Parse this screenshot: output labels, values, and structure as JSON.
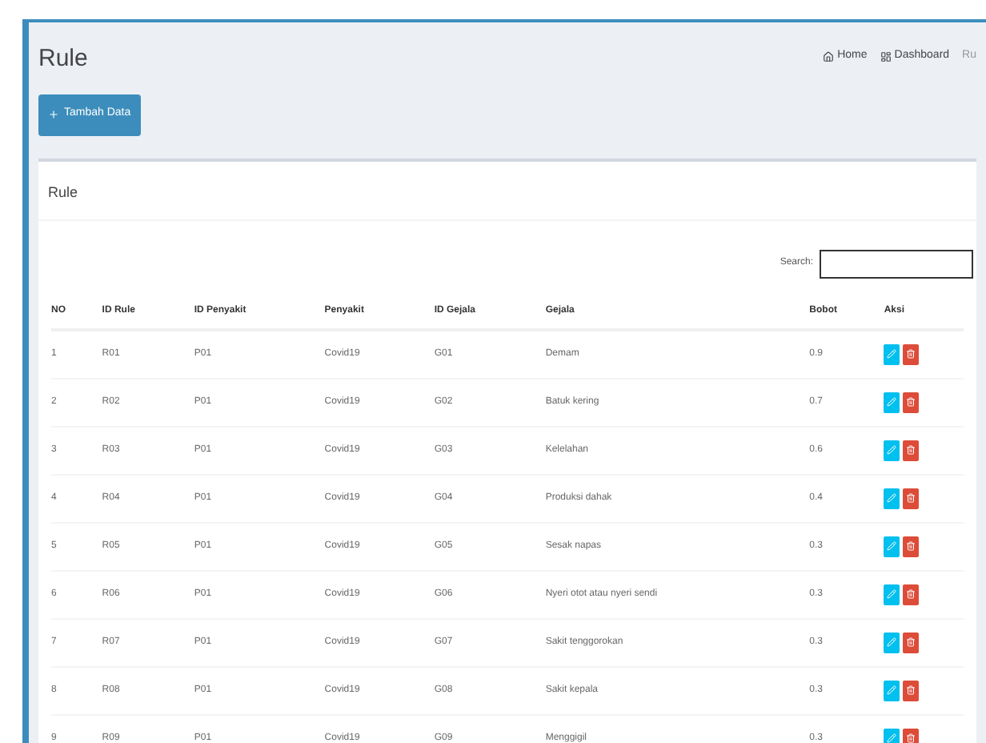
{
  "page_title": "Rule",
  "breadcrumb": [
    "Home",
    "Dashboard",
    "Ru"
  ],
  "add_button": "Tambah Data",
  "panel_title": "Rule",
  "search": {
    "label": "Search:"
  },
  "table": {
    "columns": [
      "NO",
      "ID Rule",
      "ID Penyakit",
      "Penyakit",
      "ID Gejala",
      "Gejala",
      "Bobot",
      "Aksi"
    ],
    "rows": [
      [
        "1",
        "R01",
        "P01",
        "Covid19",
        "G01",
        "Demam",
        "0.9"
      ],
      [
        "2",
        "R02",
        "P01",
        "Covid19",
        "G02",
        "Batuk kering",
        "0.7"
      ],
      [
        "3",
        "R03",
        "P01",
        "Covid19",
        "G03",
        "Kelelahan",
        "0.6"
      ],
      [
        "4",
        "R04",
        "P01",
        "Covid19",
        "G04",
        "Produksi dahak",
        "0.4"
      ],
      [
        "5",
        "R05",
        "P01",
        "Covid19",
        "G05",
        "Sesak napas",
        "0.3"
      ],
      [
        "6",
        "R06",
        "P01",
        "Covid19",
        "G06",
        "Nyeri otot atau nyeri sendi",
        "0.3"
      ],
      [
        "7",
        "R07",
        "P01",
        "Covid19",
        "G07",
        "Sakit tenggorokan",
        "0.3"
      ],
      [
        "8",
        "R08",
        "P01",
        "Covid19",
        "G08",
        "Sakit kepala",
        "0.3"
      ],
      [
        "9",
        "R09",
        "P01",
        "Covid19",
        "G09",
        "Menggigil",
        "0.3"
      ]
    ]
  }
}
